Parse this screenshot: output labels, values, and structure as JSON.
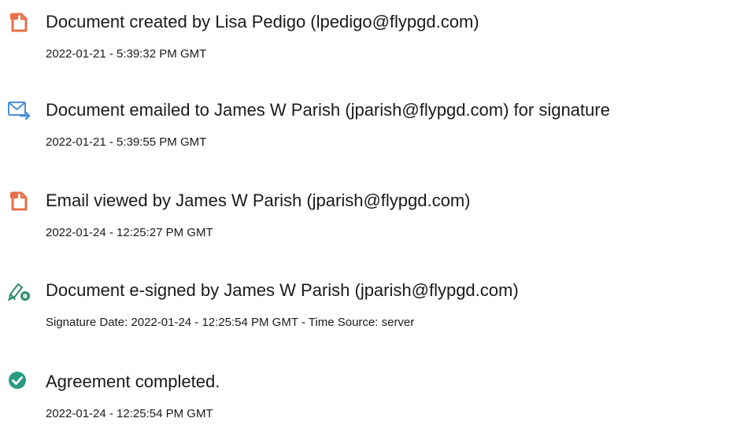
{
  "events": [
    {
      "icon": "document-created-icon",
      "title": "Document created by Lisa Pedigo (lpedigo@flypgd.com)",
      "detail": "2022-01-21 - 5:39:32 PM GMT"
    },
    {
      "icon": "email-sent-icon",
      "title": "Document emailed to James W Parish (jparish@flypgd.com) for signature",
      "detail": "2022-01-21 - 5:39:55 PM GMT"
    },
    {
      "icon": "document-viewed-icon",
      "title": "Email viewed by James W Parish (jparish@flypgd.com)",
      "detail": "2022-01-24 - 12:25:27 PM GMT"
    },
    {
      "icon": "e-sign-icon",
      "title": "Document e-signed by James W Parish (jparish@flypgd.com)",
      "detail": "Signature Date: 2022-01-24 - 12:25:54 PM GMT - Time Source: server"
    },
    {
      "icon": "checkmark-icon",
      "title": "Agreement completed.",
      "detail": "2022-01-24 - 12:25:54 PM GMT"
    }
  ],
  "colors": {
    "doc_icon": "#E8704A",
    "email_icon": "#4A8FD8",
    "sign_icon": "#2E8A6A",
    "check_icon": "#2A9C83",
    "text": "#1a1a1a"
  }
}
